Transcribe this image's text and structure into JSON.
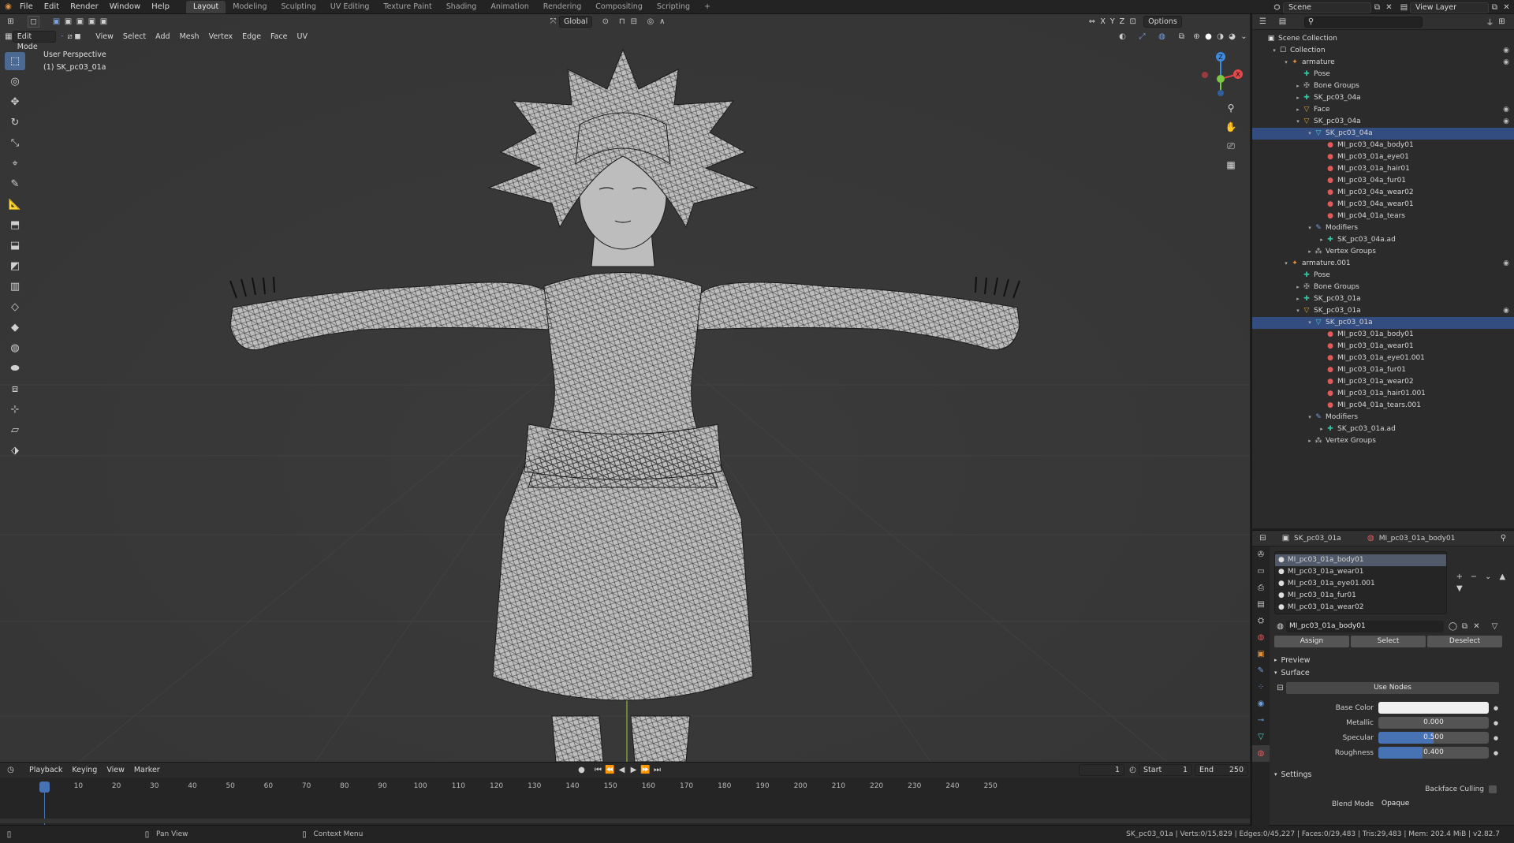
{
  "topbar": {
    "menus": [
      "File",
      "Edit",
      "Render",
      "Window",
      "Help"
    ],
    "workspaces": [
      "Layout",
      "Modeling",
      "Sculpting",
      "UV Editing",
      "Texture Paint",
      "Shading",
      "Animation",
      "Rendering",
      "Compositing",
      "Scripting"
    ],
    "active_workspace": "Layout",
    "scene": "Scene",
    "view_layer": "View Layer"
  },
  "viewport": {
    "mode": "Edit Mode",
    "menus": [
      "View",
      "Select",
      "Add",
      "Mesh",
      "Vertex",
      "Edge",
      "Face",
      "UV"
    ],
    "orientation": "Global",
    "options_label": "Options",
    "axes": [
      "X",
      "Y",
      "Z"
    ],
    "perspective": "User Perspective",
    "object_label": "(1) SK_pc03_01a"
  },
  "timeline": {
    "menus": [
      "Playback",
      "Keying",
      "View",
      "Marker"
    ],
    "current_frame": "1",
    "start_label": "Start",
    "start": "1",
    "end_label": "End",
    "end": "250",
    "ticks": [
      "1",
      "10",
      "20",
      "30",
      "40",
      "50",
      "60",
      "70",
      "80",
      "90",
      "100",
      "110",
      "120",
      "130",
      "140",
      "150",
      "160",
      "170",
      "180",
      "190",
      "200",
      "210",
      "220",
      "230",
      "240",
      "250"
    ]
  },
  "statusbar": {
    "pan": "Pan View",
    "context": "Context Menu",
    "stats": "SK_pc03_01a | Verts:0/15,829 | Edges:0/45,227 | Faces:0/29,483 | Tris:29,483 | Mem: 202.4 MiB | v2.82.7"
  },
  "outliner": {
    "rows": [
      {
        "label": "Scene Collection",
        "icon": "collection-icon",
        "glyph": "▣",
        "cls": "coll",
        "indent": 0,
        "arrow": "",
        "eye": false,
        "selected": false
      },
      {
        "label": "Collection",
        "icon": "collection-icon",
        "glyph": "☐",
        "cls": "coll",
        "indent": 1,
        "arrow": "▾",
        "eye": true,
        "selected": false
      },
      {
        "label": "armature",
        "icon": "armature-icon",
        "glyph": "✦",
        "cls": "arm",
        "indent": 2,
        "arrow": "▾",
        "eye": true,
        "selected": false
      },
      {
        "label": "Pose",
        "icon": "pose-icon",
        "glyph": "✚",
        "cls": "pose",
        "indent": 3,
        "arrow": "",
        "eye": false,
        "selected": false
      },
      {
        "label": "Bone Groups",
        "icon": "bone-group-icon",
        "glyph": "✠",
        "cls": "bone",
        "indent": 3,
        "arrow": "▸",
        "eye": false,
        "selected": false
      },
      {
        "label": "SK_pc03_04a",
        "icon": "armature-data-icon",
        "glyph": "✚",
        "cls": "pose",
        "indent": 3,
        "arrow": "▸",
        "eye": false,
        "selected": false
      },
      {
        "label": "Face",
        "icon": "mesh-object-icon",
        "glyph": "▽",
        "cls": "tri",
        "indent": 3,
        "arrow": "▸",
        "eye": true,
        "selected": false
      },
      {
        "label": "SK_pc03_04a",
        "icon": "mesh-object-icon",
        "glyph": "▽",
        "cls": "tri",
        "indent": 3,
        "arrow": "▾",
        "eye": true,
        "selected": false
      },
      {
        "label": "SK_pc03_04a",
        "icon": "mesh-data-icon",
        "glyph": "▽",
        "cls": "mesh",
        "indent": 4,
        "arrow": "▾",
        "eye": false,
        "selected": true
      },
      {
        "label": "MI_pc03_04a_body01",
        "icon": "material-icon",
        "glyph": "●",
        "cls": "mat",
        "indent": 5,
        "arrow": "",
        "eye": false,
        "selected": false
      },
      {
        "label": "MI_pc03_01a_eye01",
        "icon": "material-icon",
        "glyph": "●",
        "cls": "mat",
        "indent": 5,
        "arrow": "",
        "eye": false,
        "selected": false
      },
      {
        "label": "MI_pc03_01a_hair01",
        "icon": "material-icon",
        "glyph": "●",
        "cls": "mat",
        "indent": 5,
        "arrow": "",
        "eye": false,
        "selected": false
      },
      {
        "label": "MI_pc03_04a_fur01",
        "icon": "material-icon",
        "glyph": "●",
        "cls": "mat",
        "indent": 5,
        "arrow": "",
        "eye": false,
        "selected": false
      },
      {
        "label": "MI_pc03_04a_wear02",
        "icon": "material-icon",
        "glyph": "●",
        "cls": "mat",
        "indent": 5,
        "arrow": "",
        "eye": false,
        "selected": false
      },
      {
        "label": "MI_pc03_04a_wear01",
        "icon": "material-icon",
        "glyph": "●",
        "cls": "mat",
        "indent": 5,
        "arrow": "",
        "eye": false,
        "selected": false
      },
      {
        "label": "MI_pc04_01a_tears",
        "icon": "material-icon",
        "glyph": "●",
        "cls": "mat",
        "indent": 5,
        "arrow": "",
        "eye": false,
        "selected": false
      },
      {
        "label": "Modifiers",
        "icon": "wrench-icon",
        "glyph": "✎",
        "cls": "mod",
        "indent": 4,
        "arrow": "▾",
        "eye": false,
        "selected": false
      },
      {
        "label": "SK_pc03_04a.ad",
        "icon": "armature-modifier-icon",
        "glyph": "✚",
        "cls": "pose",
        "indent": 5,
        "arrow": "▸",
        "eye": false,
        "selected": false
      },
      {
        "label": "Vertex Groups",
        "icon": "vertex-group-icon",
        "glyph": "⁂",
        "cls": "vg",
        "indent": 4,
        "arrow": "▸",
        "eye": false,
        "selected": false
      },
      {
        "label": "armature.001",
        "icon": "armature-icon",
        "glyph": "✦",
        "cls": "arm",
        "indent": 2,
        "arrow": "▾",
        "eye": true,
        "selected": false
      },
      {
        "label": "Pose",
        "icon": "pose-icon",
        "glyph": "✚",
        "cls": "pose",
        "indent": 3,
        "arrow": "",
        "eye": false,
        "selected": false
      },
      {
        "label": "Bone Groups",
        "icon": "bone-group-icon",
        "glyph": "✠",
        "cls": "bone",
        "indent": 3,
        "arrow": "▸",
        "eye": false,
        "selected": false
      },
      {
        "label": "SK_pc03_01a",
        "icon": "armature-data-icon",
        "glyph": "✚",
        "cls": "pose",
        "indent": 3,
        "arrow": "▸",
        "eye": false,
        "selected": false
      },
      {
        "label": "SK_pc03_01a",
        "icon": "mesh-object-icon",
        "glyph": "▽",
        "cls": "tri",
        "indent": 3,
        "arrow": "▾",
        "eye": true,
        "selected": false
      },
      {
        "label": "SK_pc03_01a",
        "icon": "mesh-data-icon",
        "glyph": "▽",
        "cls": "mesh",
        "indent": 4,
        "arrow": "▾",
        "eye": false,
        "selected": true
      },
      {
        "label": "MI_pc03_01a_body01",
        "icon": "material-icon",
        "glyph": "●",
        "cls": "mat",
        "indent": 5,
        "arrow": "",
        "eye": false,
        "selected": false
      },
      {
        "label": "MI_pc03_01a_wear01",
        "icon": "material-icon",
        "glyph": "●",
        "cls": "mat",
        "indent": 5,
        "arrow": "",
        "eye": false,
        "selected": false
      },
      {
        "label": "MI_pc03_01a_eye01.001",
        "icon": "material-icon",
        "glyph": "●",
        "cls": "mat",
        "indent": 5,
        "arrow": "",
        "eye": false,
        "selected": false
      },
      {
        "label": "MI_pc03_01a_fur01",
        "icon": "material-icon",
        "glyph": "●",
        "cls": "mat",
        "indent": 5,
        "arrow": "",
        "eye": false,
        "selected": false
      },
      {
        "label": "MI_pc03_01a_wear02",
        "icon": "material-icon",
        "glyph": "●",
        "cls": "mat",
        "indent": 5,
        "arrow": "",
        "eye": false,
        "selected": false
      },
      {
        "label": "MI_pc03_01a_hair01.001",
        "icon": "material-icon",
        "glyph": "●",
        "cls": "mat",
        "indent": 5,
        "arrow": "",
        "eye": false,
        "selected": false
      },
      {
        "label": "MI_pc04_01a_tears.001",
        "icon": "material-icon",
        "glyph": "●",
        "cls": "mat",
        "indent": 5,
        "arrow": "",
        "eye": false,
        "selected": false
      },
      {
        "label": "Modifiers",
        "icon": "wrench-icon",
        "glyph": "✎",
        "cls": "mod",
        "indent": 4,
        "arrow": "▾",
        "eye": false,
        "selected": false
      },
      {
        "label": "SK_pc03_01a.ad",
        "icon": "armature-modifier-icon",
        "glyph": "✚",
        "cls": "pose",
        "indent": 5,
        "arrow": "▸",
        "eye": false,
        "selected": false
      },
      {
        "label": "Vertex Groups",
        "icon": "vertex-group-icon",
        "glyph": "⁂",
        "cls": "vg",
        "indent": 4,
        "arrow": "▸",
        "eye": false,
        "selected": false
      }
    ]
  },
  "properties": {
    "object_name": "SK_pc03_01a",
    "material_name": "MI_pc03_01a_body01",
    "slots": [
      "MI_pc03_01a_body01",
      "MI_pc03_01a_wear01",
      "MI_pc03_01a_eye01.001",
      "MI_pc03_01a_fur01",
      "MI_pc03_01a_wear02"
    ],
    "selected_slot": 0,
    "material_field": "MI_pc03_01a_body01",
    "assign": "Assign",
    "select": "Select",
    "deselect": "Deselect",
    "preview": "Preview",
    "surface": "Surface",
    "use_nodes": "Use Nodes",
    "base_color_label": "Base Color",
    "base_color": "#f0f0f0",
    "metallic_label": "Metallic",
    "metallic": "0.000",
    "metallic_value": 0.0,
    "specular_label": "Specular",
    "specular": "0.500",
    "specular_value": 0.5,
    "roughness_label": "Roughness",
    "roughness": "0.400",
    "roughness_value": 0.4,
    "settings": "Settings",
    "backface_label": "Backface Culling",
    "blend_mode_label": "Blend Mode",
    "blend_mode": "Opaque"
  },
  "colors": {
    "accent": "#4772b3",
    "selection": "#334d80",
    "viewport_bg": "#393939",
    "gizmo_x": "#e2474a",
    "gizmo_y": "#7ac943",
    "gizmo_z": "#3d8be0"
  }
}
